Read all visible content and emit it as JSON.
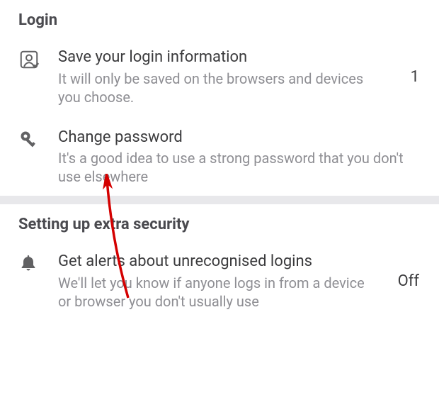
{
  "sections": {
    "login": {
      "header": "Login",
      "items": {
        "save_login": {
          "title": "Save your login information",
          "desc": "It will only be saved on the browsers and devices you choose.",
          "value": "1"
        },
        "change_password": {
          "title": "Change password",
          "desc": "It's a good idea to use a strong password that you don't use elsewhere"
        }
      }
    },
    "extra_security": {
      "header": "Setting up extra security",
      "items": {
        "alerts": {
          "title": "Get alerts about unrecognised logins",
          "desc": "We'll let you know if anyone logs in from a device or browser you don't usually use",
          "value": "Off"
        }
      }
    }
  },
  "annotation": {
    "arrow_color": "#d40000"
  }
}
